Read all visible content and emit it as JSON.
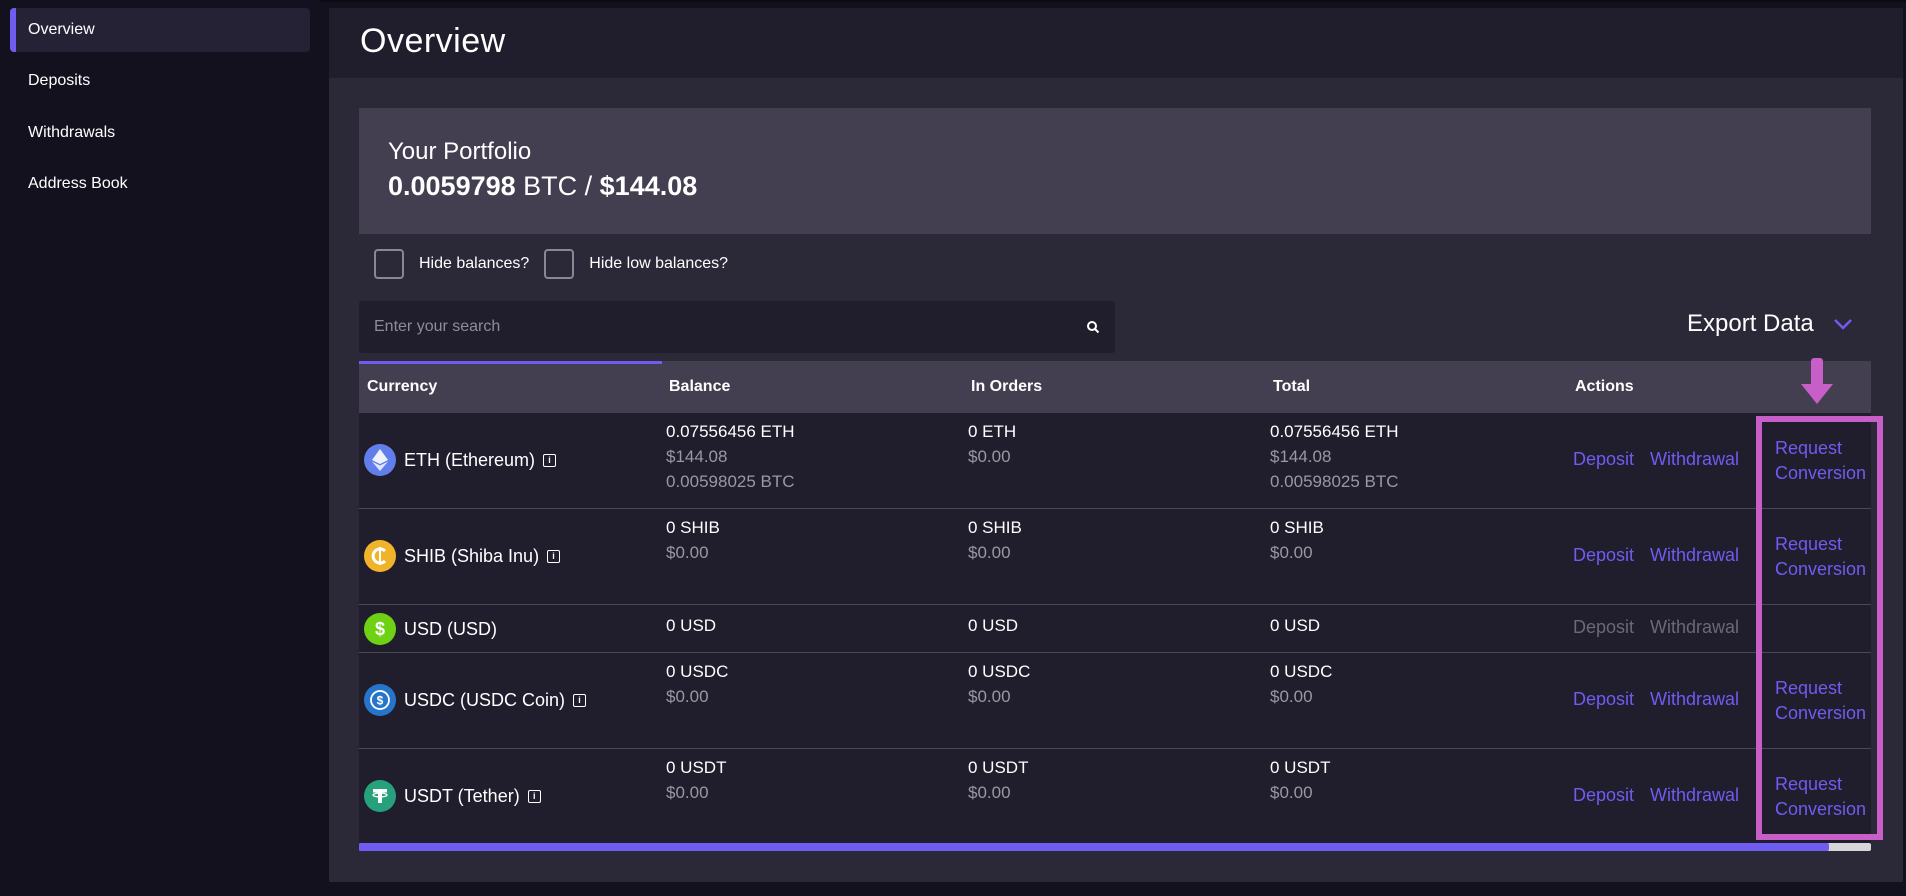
{
  "sidebar": {
    "items": [
      {
        "label": "Overview",
        "active": true
      },
      {
        "label": "Deposits",
        "active": false
      },
      {
        "label": "Withdrawals",
        "active": false
      },
      {
        "label": "Address Book",
        "active": false
      }
    ]
  },
  "header": {
    "title": "Overview"
  },
  "portfolio": {
    "title": "Your Portfolio",
    "btc_amount": "0.0059798",
    "btc_unit": " BTC / ",
    "usd_amount": "$144.08"
  },
  "filters": {
    "hide_balances": "Hide balances?",
    "hide_low_balances": "Hide low balances?"
  },
  "search": {
    "placeholder": "Enter your search",
    "icon": "search-icon"
  },
  "export": {
    "label": "Export Data",
    "icon": "chevron-down-icon"
  },
  "table": {
    "columns": [
      "Currency",
      "Balance",
      "In Orders",
      "Total",
      "Actions"
    ],
    "rows": [
      {
        "name": "ETH (Ethereum)",
        "icon": "ethereum-icon",
        "color": "#627eea",
        "balance": [
          "0.07556456 ETH",
          "$144.08",
          "0.00598025 BTC"
        ],
        "in_orders": [
          "0 ETH",
          "$0.00"
        ],
        "total": [
          "0.07556456 ETH",
          "$144.08",
          "0.00598025 BTC"
        ],
        "deposit": "Deposit",
        "withdrawal": "Withdrawal",
        "conversion": [
          "Request",
          "Conversion"
        ]
      },
      {
        "name": "SHIB (Shiba Inu)",
        "icon": "shiba-icon",
        "color": "#f0b42b",
        "balance": [
          "0 SHIB",
          "$0.00"
        ],
        "in_orders": [
          "0 SHIB",
          "$0.00"
        ],
        "total": [
          "0 SHIB",
          "$0.00"
        ],
        "deposit": "Deposit",
        "withdrawal": "Withdrawal",
        "conversion": [
          "Request",
          "Conversion"
        ]
      },
      {
        "name": "USD (USD)",
        "icon": "dollar-icon",
        "color": "#6fd113",
        "balance": [
          "0 USD"
        ],
        "in_orders": [
          "0 USD"
        ],
        "total": [
          "0 USD"
        ],
        "deposit": "Deposit",
        "withdrawal": "Withdrawal"
      },
      {
        "name": "USDC (USDC Coin)",
        "icon": "usdc-icon",
        "color": "#2775ca",
        "balance": [
          "0 USDC",
          "$0.00"
        ],
        "in_orders": [
          "0 USDC",
          "$0.00"
        ],
        "total": [
          "0 USDC",
          "$0.00"
        ],
        "deposit": "Deposit",
        "withdrawal": "Withdrawal",
        "conversion": [
          "Request",
          "Conversion"
        ]
      },
      {
        "name": "USDT (Tether)",
        "icon": "tether-icon",
        "color": "#26a17b",
        "balance": [
          "0 USDT",
          "$0.00"
        ],
        "in_orders": [
          "0 USDT",
          "$0.00"
        ],
        "total": [
          "0 USDT",
          "$0.00"
        ],
        "deposit": "Deposit",
        "withdrawal": "Withdrawal",
        "conversion": [
          "Request",
          "Conversion"
        ]
      }
    ]
  },
  "colors": {
    "accent": "#6f5cf1",
    "annotation": "#c85fc8"
  }
}
